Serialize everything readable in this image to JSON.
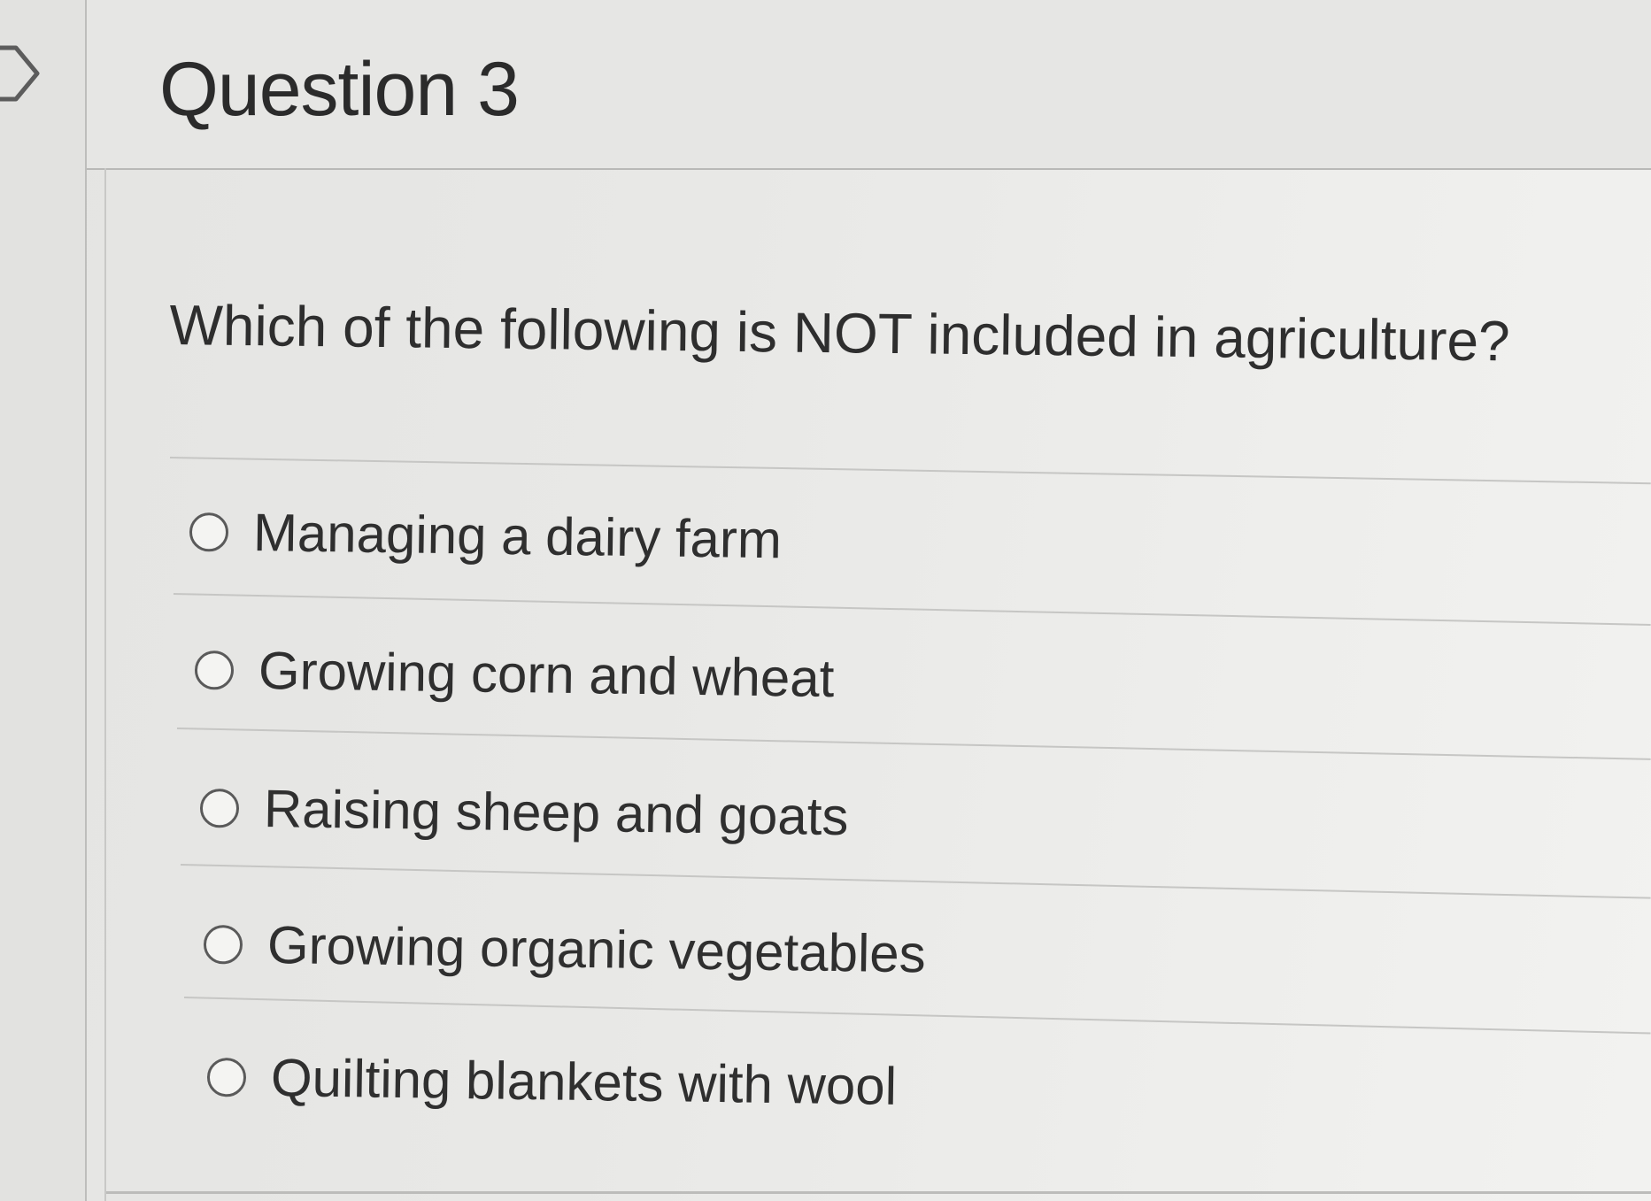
{
  "question": {
    "title": "Question 3",
    "prompt": "Which of the following is NOT included in agriculture?"
  },
  "options": [
    {
      "label": "Managing a dairy farm",
      "selected": false
    },
    {
      "label": "Growing corn and wheat",
      "selected": false
    },
    {
      "label": "Raising sheep and goats",
      "selected": false
    },
    {
      "label": "Growing organic vegetables",
      "selected": false
    },
    {
      "label": "Quilting blankets with wool",
      "selected": false
    }
  ],
  "nav": {
    "icon": "chevron-right-icon"
  }
}
